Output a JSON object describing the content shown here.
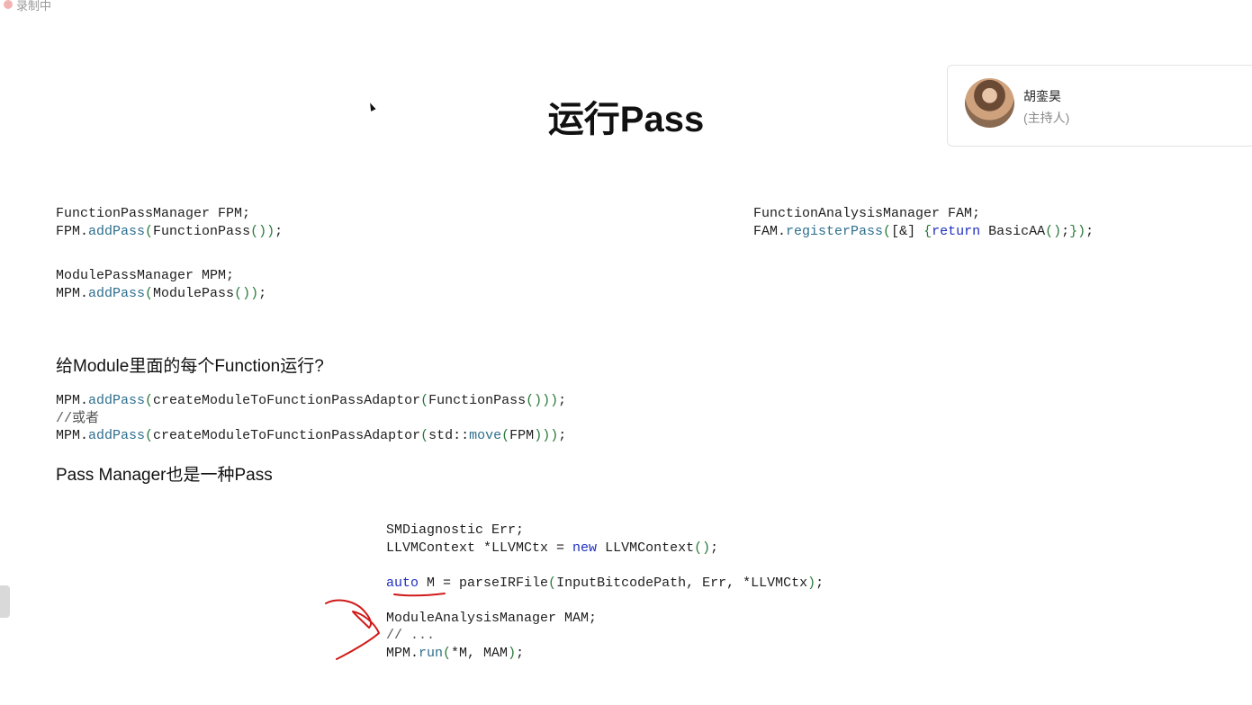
{
  "recording": {
    "label": "录制中"
  },
  "slide": {
    "title": "运行Pass",
    "question": "给Module里面的每个Function运行?",
    "statement": "Pass Manager也是一种Pass"
  },
  "presenter": {
    "name": "胡銮昊",
    "role": "(主持人)"
  },
  "code": {
    "fpm": [
      "FunctionPassManager FPM;",
      "FPM.addPass(FunctionPass());"
    ],
    "mpm": [
      "ModulePassManager MPM;",
      "MPM.addPass(ModulePass());"
    ],
    "fam": [
      "FunctionAnalysisManager FAM;",
      "FAM.registerPass([&] {return BasicAA();});"
    ],
    "adaptor": [
      "MPM.addPass(createModuleToFunctionPassAdaptor(FunctionPass()));",
      "//或者",
      "MPM.addPass(createModuleToFunctionPassAdaptor(std::move(FPM)));"
    ],
    "run": [
      "SMDiagnostic Err;",
      "LLVMContext *LLVMCtx = new LLVMContext();",
      "",
      "auto M = parseIRFile(InputBitcodePath, Err, *LLVMCtx);",
      "",
      "ModuleAnalysisManager MAM;",
      "// ...",
      "MPM.run(*M, MAM);"
    ]
  },
  "colors": {
    "method": "#2e6f8e",
    "paren": "#2a7a3a",
    "keyword": "#1d2fbf",
    "annotation": "#d11a1a"
  },
  "icons": [
    "record-dot-icon",
    "mouse-cursor-icon",
    "avatar"
  ]
}
